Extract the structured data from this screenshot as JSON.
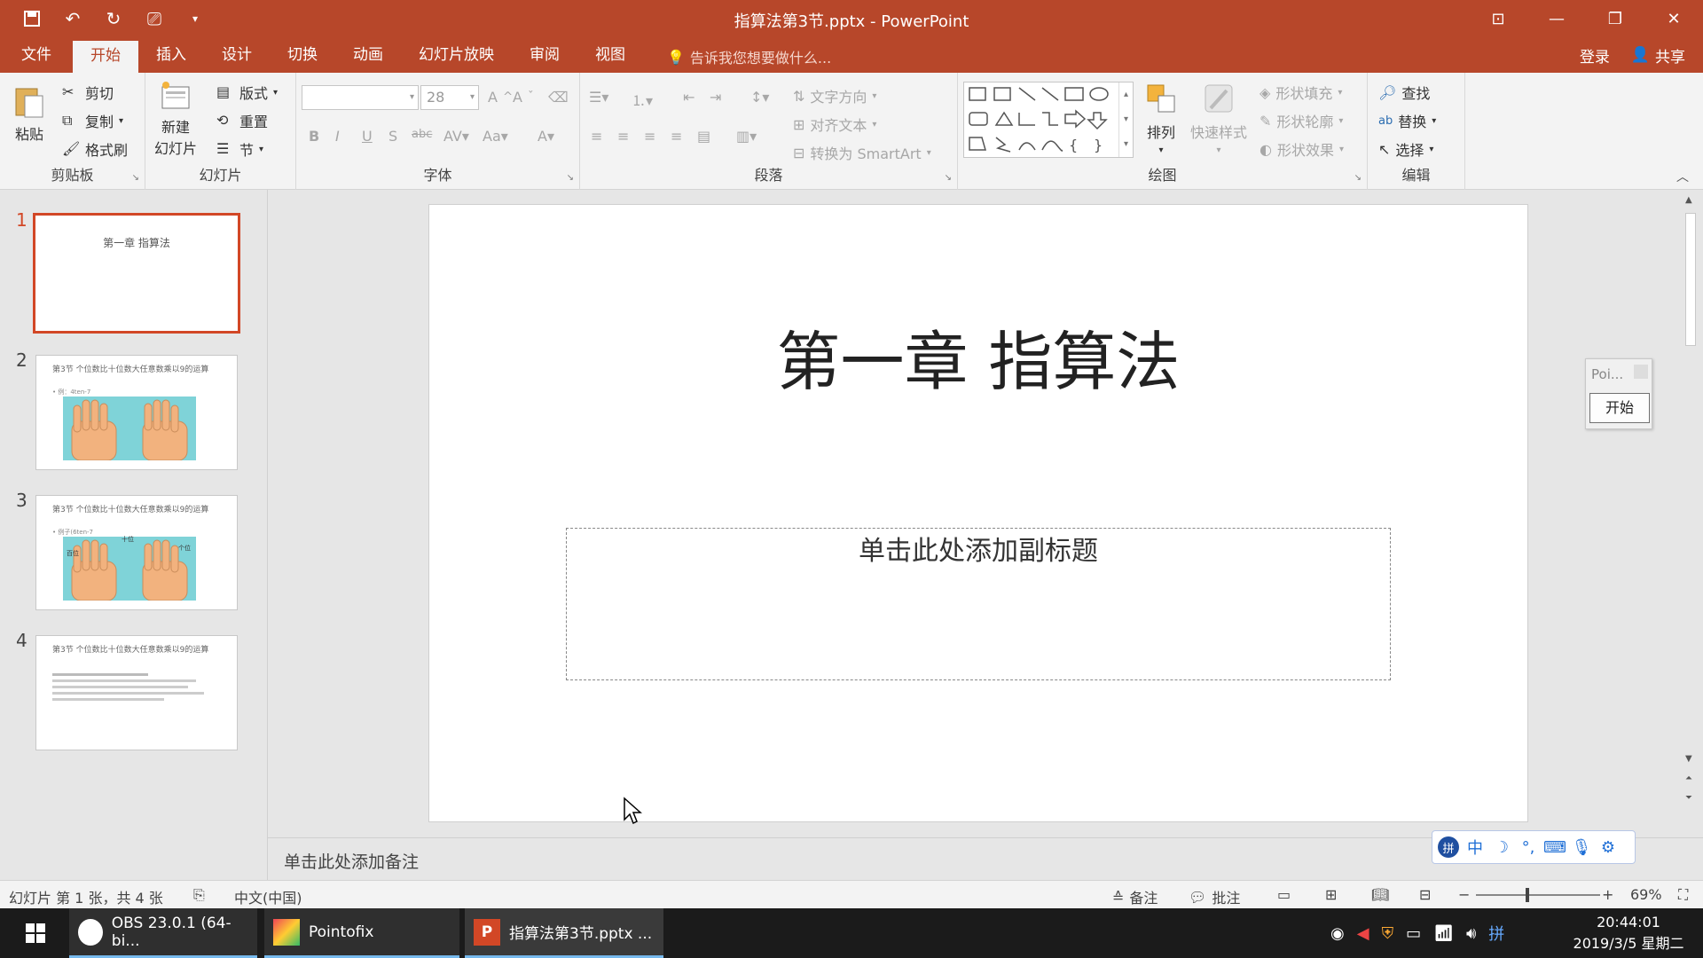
{
  "window": {
    "title": "指算法第3节.pptx - PowerPoint"
  },
  "tabs": {
    "items": [
      "文件",
      "开始",
      "插入",
      "设计",
      "切换",
      "动画",
      "幻灯片放映",
      "审阅",
      "视图"
    ],
    "tellme": "告诉我您想要做什么...",
    "login": "登录",
    "share": "共享"
  },
  "ribbon": {
    "clipboard": {
      "paste": "粘贴",
      "cut": "剪切",
      "copy": "复制",
      "format_painter": "格式刷",
      "label": "剪贴板"
    },
    "slides": {
      "new_slide_1": "新建",
      "new_slide_2": "幻灯片",
      "layout": "版式",
      "reset": "重置",
      "section": "节",
      "label": "幻灯片"
    },
    "font": {
      "font_name": "",
      "font_size": "28",
      "label": "字体"
    },
    "paragraph": {
      "text_direction": "文字方向",
      "align_text": "对齐文本",
      "smartart": "转换为 SmartArt",
      "label": "段落"
    },
    "drawing": {
      "arrange": "排列",
      "quick_styles": "快速样式",
      "shape_fill": "形状填充",
      "shape_outline": "形状轮廓",
      "shape_effects": "形状效果",
      "label": "绘图"
    },
    "editing": {
      "find": "查找",
      "replace": "替换",
      "select": "选择",
      "label": "编辑"
    }
  },
  "thumbnails": [
    {
      "num": "1",
      "title": "第一章 指算法"
    },
    {
      "num": "2",
      "title": "第3节 个位数比十位数大任意数乘以9的运算",
      "sub": "• 例：4ten-7"
    },
    {
      "num": "3",
      "title": "第3节 个位数比十位数大任意数乘以9的运算",
      "sub": "• 例子(6ten-7",
      "labels": [
        "十位",
        "百位",
        "个位"
      ]
    },
    {
      "num": "4",
      "title": "第3节 个位数比十位数大任意数乘以9的运算"
    }
  ],
  "slide": {
    "title": "第一章 指算法",
    "subtitle_placeholder": "单击此处添加副标题"
  },
  "notes": {
    "placeholder": "单击此处添加备注"
  },
  "status": {
    "slide_info": "幻灯片 第 1 张，共 4 张",
    "language": "中文(中国)",
    "notes": "备注",
    "comments": "批注",
    "zoom": "69%"
  },
  "pointofix_panel": {
    "title": "Poi...",
    "start": "开始"
  },
  "taskbar": {
    "obs": "OBS 23.0.1 (64-bi...",
    "pointofix": "Pointofix",
    "powerpoint": "指算法第3节.pptx ...",
    "time": "20:44:01",
    "date": "2019/3/5 星期二"
  },
  "colors": {
    "brand": "#b7472a",
    "accent": "#d24726"
  }
}
